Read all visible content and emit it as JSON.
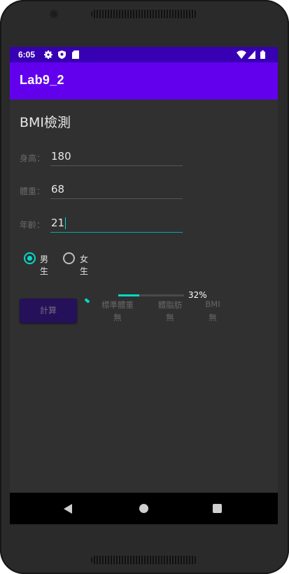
{
  "status_bar": {
    "time": "6:05",
    "icons": [
      "gear-icon",
      "shield-icon",
      "sd-card-icon",
      "wifi-icon",
      "signal-icon",
      "battery-icon"
    ]
  },
  "app_bar": {
    "title": "Lab9_2"
  },
  "page_title": "BMI檢測",
  "fields": [
    {
      "label": "身高：",
      "value": "180",
      "focused": false
    },
    {
      "label": "體重：",
      "value": "68",
      "focused": false
    },
    {
      "label": "年齡：",
      "value": "21",
      "focused": true
    }
  ],
  "gender": {
    "options": [
      {
        "label": "男生",
        "checked": true
      },
      {
        "label": "女生",
        "checked": false
      }
    ]
  },
  "calculate_button": {
    "label": "計算"
  },
  "progress": {
    "percent": 32,
    "text": "32%"
  },
  "results": [
    {
      "label": "標準體重",
      "value": "無"
    },
    {
      "label": "體脂肪",
      "value": "無"
    },
    {
      "label": "BMI",
      "value": "無"
    }
  ],
  "nav_bar": {
    "icons": [
      "back-icon",
      "home-icon",
      "recents-icon"
    ]
  },
  "colors": {
    "status_bar": "#3700b3",
    "app_bar": "#6200ee",
    "accent": "#03dac5",
    "screen_bg": "#303030",
    "button_bg": "#25105a"
  }
}
